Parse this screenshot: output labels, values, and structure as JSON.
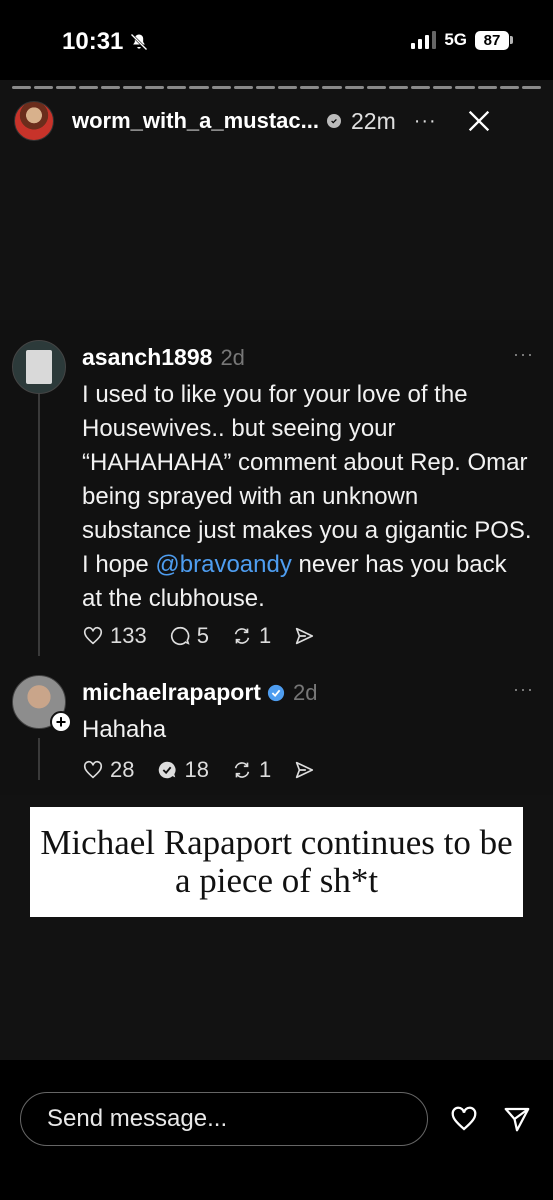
{
  "status_bar": {
    "time": "10:31",
    "network": "5G",
    "battery": "87",
    "silent_icon": "bell-slash-icon"
  },
  "story": {
    "username": "worm_with_a_mustac...",
    "time_ago": "22m",
    "more_label": "···",
    "close_icon": "close-icon"
  },
  "thread": {
    "comments": [
      {
        "username": "asanch1898",
        "age": "2d",
        "text_before": "I used to like you for your love of the Housewives.. but seeing your “HAHAHAHA” comment about Rep. Omar being sprayed with an unknown substance just makes you a gigantic POS.  I hope ",
        "mention": "@bravoandy",
        "text_after": " never has you back at the clubhouse.",
        "likes": "133",
        "replies": "5",
        "reposts": "1",
        "more": "···"
      },
      {
        "username": "michaelrapaport",
        "age": "2d",
        "text": "Hahaha",
        "likes": "28",
        "replies": "18",
        "reposts": "1",
        "more": "···"
      }
    ]
  },
  "caption": "Michael Rapaport continues to be a piece of sh*t",
  "bottom": {
    "message_placeholder": "Send message..."
  },
  "colors": {
    "mention": "#4e9df0",
    "verified": "#4e9df0",
    "background": "#121212"
  }
}
